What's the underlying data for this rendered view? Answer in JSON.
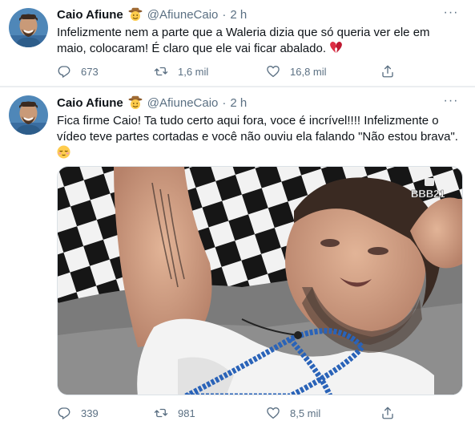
{
  "tweets": [
    {
      "author_name": "Caio Afiune",
      "author_handle": "@AfiuneCaio",
      "separator": "·",
      "time": "2 h",
      "more_glyph": "···",
      "text": "Infelizmente nem a parte que a Waleria dizia que só queria ver ele em maio, colocaram! É claro que ele vai ficar abalado.",
      "text_emoji": "broken-heart-emoji",
      "reply_count": "673",
      "retweet_count": "1,6 mil",
      "like_count": "16,8 mil"
    },
    {
      "author_name": "Caio Afiune",
      "author_handle": "@AfiuneCaio",
      "separator": "·",
      "time": "2 h",
      "more_glyph": "···",
      "text": "Fica firme Caio! Ta tudo certo aqui fora, voce é incrível!!!! Infelizmente o vídeo teve partes cortadas e você não ouviu ela falando \"Não estou brava\".",
      "text_emoji": "relieved-face-emoji",
      "media_watermark": "BBB21",
      "reply_count": "339",
      "retweet_count": "981",
      "like_count": "8,5 mil"
    }
  ],
  "icons": [
    "reply-icon",
    "retweet-icon",
    "like-icon",
    "share-icon",
    "cowboy-hat-face-emoji",
    "more-icon"
  ],
  "colors": {
    "text": "#0f1419",
    "secondary": "#5b7083",
    "divider": "#ebeef0"
  }
}
